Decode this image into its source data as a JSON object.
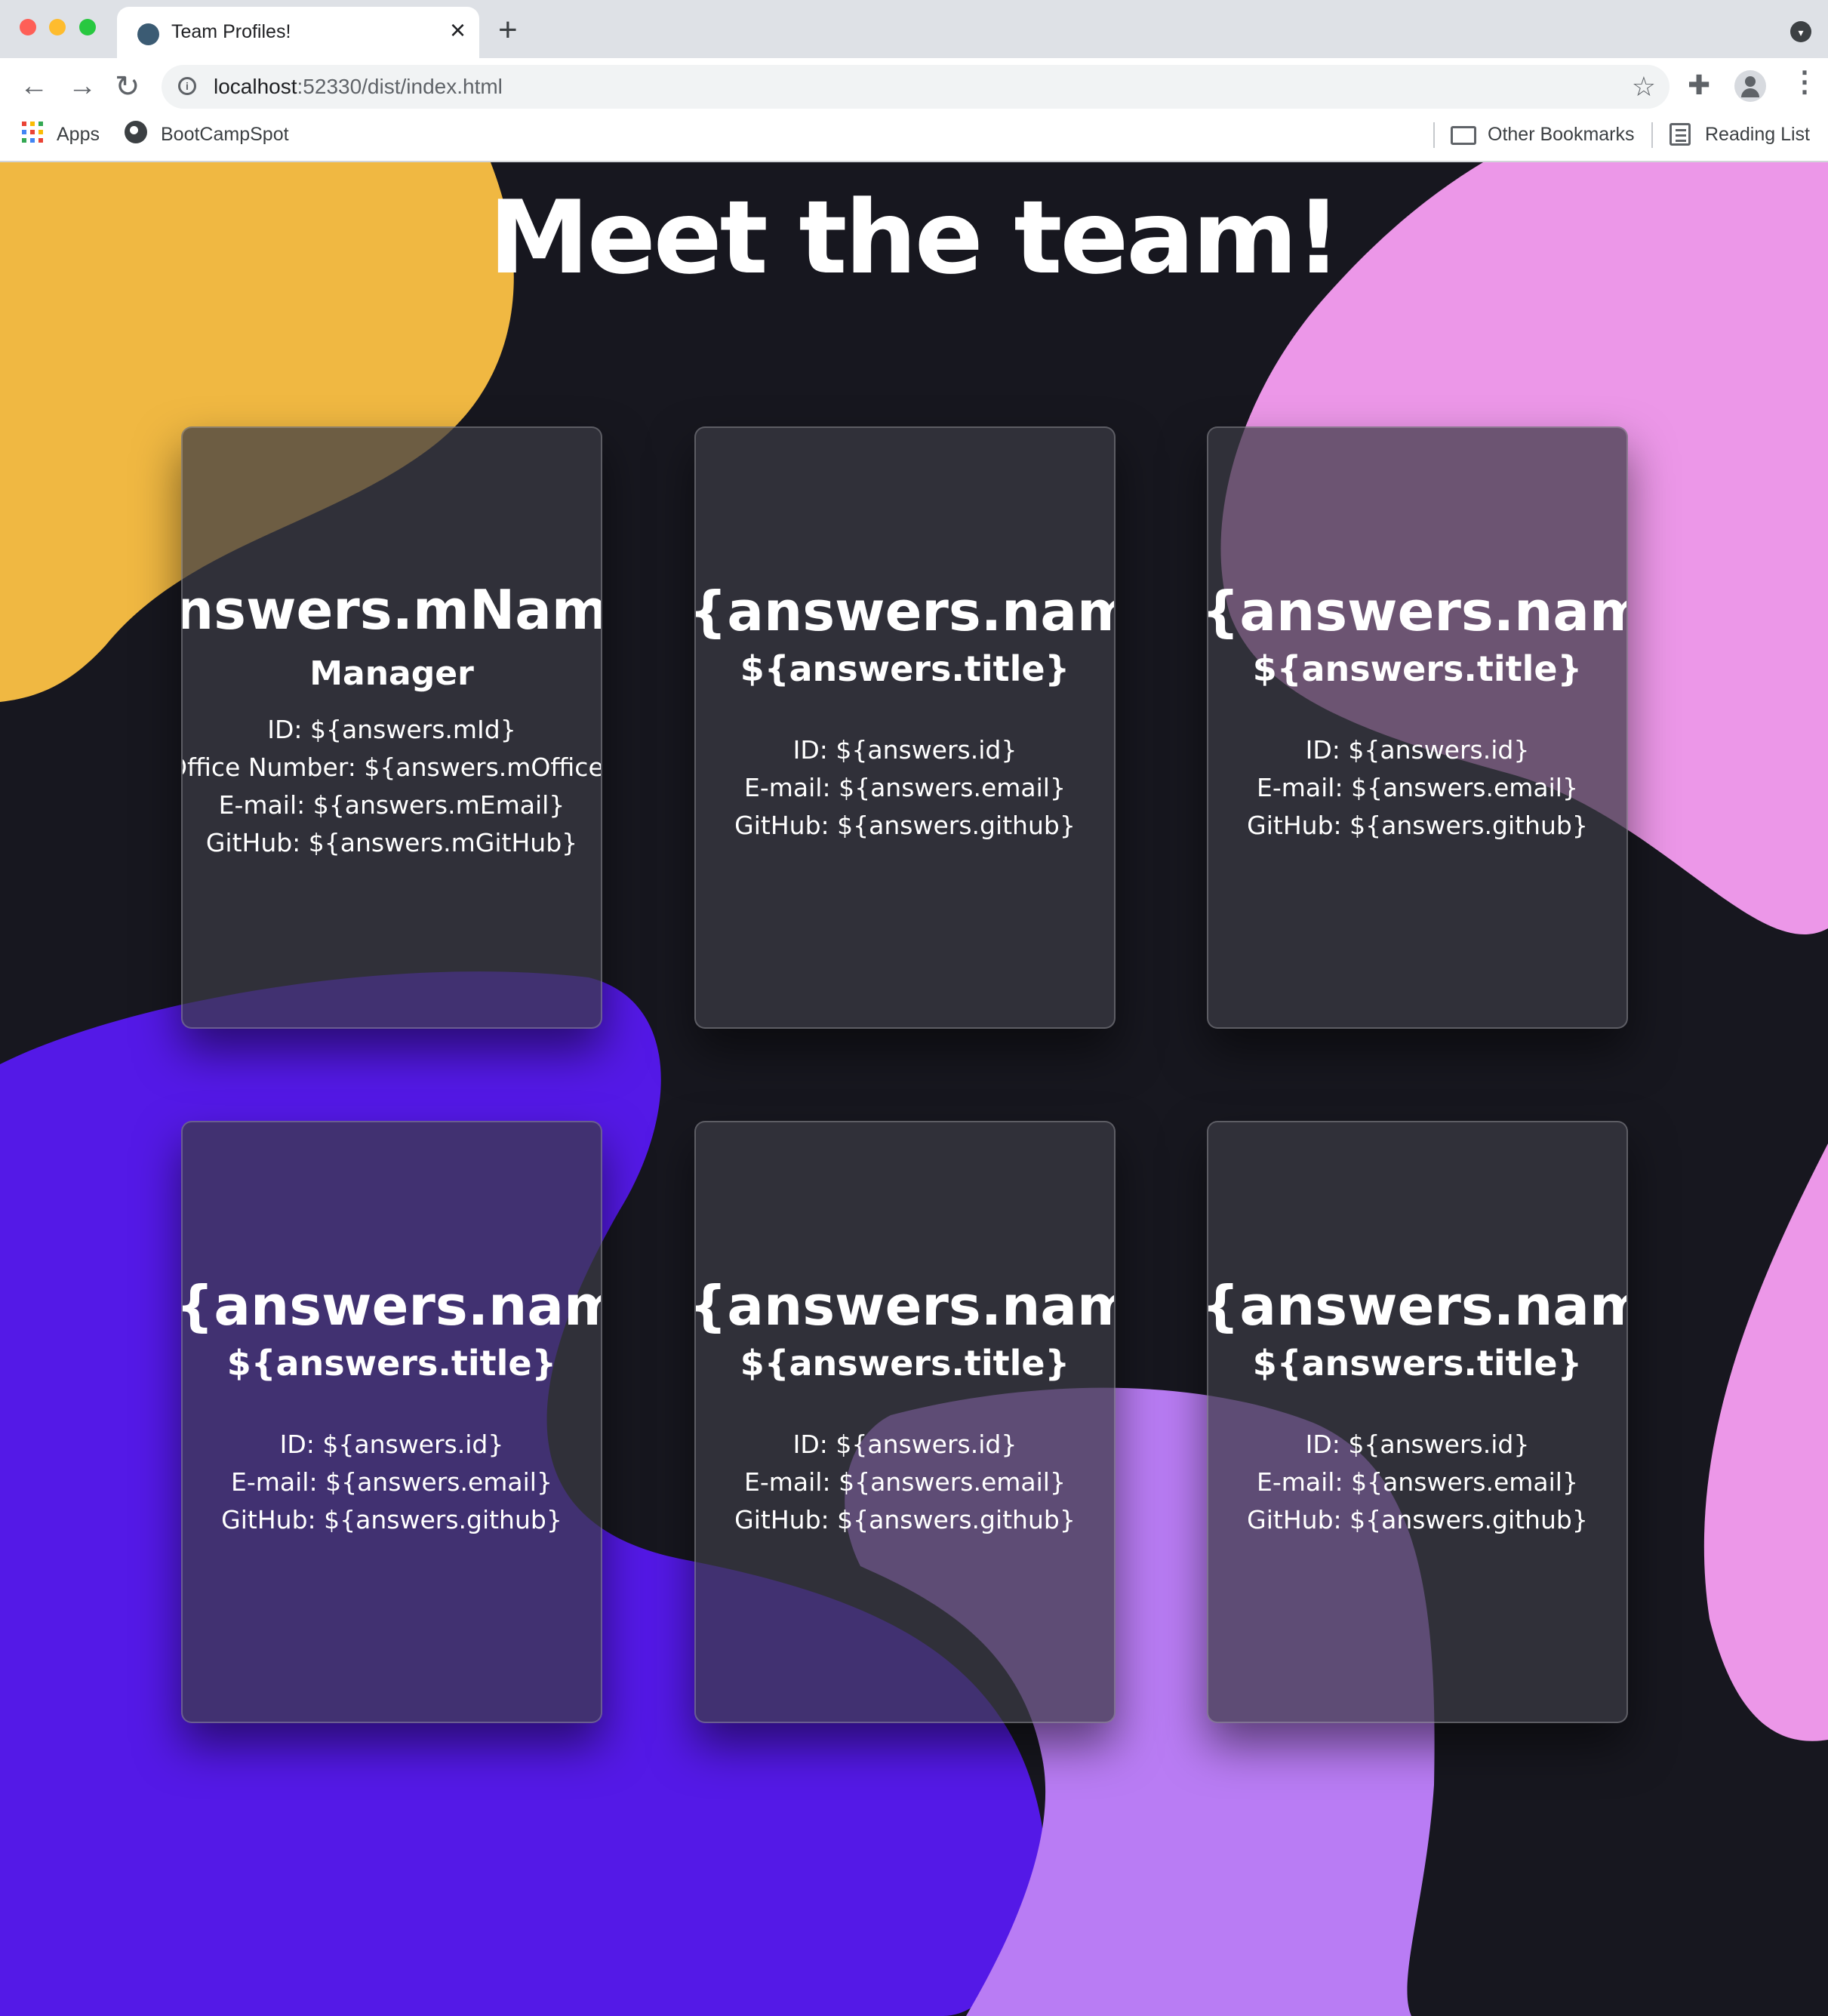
{
  "browser": {
    "tab_title": "Team Profiles!",
    "url_host": "localhost",
    "url_path": ":52330/dist/index.html",
    "bookmarks": [
      "Apps",
      "BootCampSpot"
    ],
    "other_bookmarks": "Other Bookmarks",
    "reading_list": "Reading List",
    "colors": {
      "tabstrip": "#dee1e6",
      "toolbar": "#ffffff",
      "omnibox": "#f1f3f4"
    }
  },
  "page": {
    "heading": "Meet the team!",
    "colors": {
      "background": "#17171f",
      "blob_yellow": "#f0b842",
      "blob_pink": "#ec97e8",
      "blob_indigo": "#5419e7",
      "blob_lilac": "#b97cf4"
    },
    "manager": {
      "name": "answers.mName",
      "role": "Manager",
      "id_line": "ID: ${answers.mId}",
      "office_line": "Office Number: ${answers.mOffice}",
      "email_line": "E-mail: ${answers.mEmail}",
      "github_line": "GitHub: ${answers.mGitHub}"
    },
    "members": [
      {
        "name": "${answers.name}",
        "title": "${answers.title}",
        "id_line": "ID: ${answers.id}",
        "email_line": "E-mail: ${answers.email}",
        "github_line": "GitHub: ${answers.github}"
      },
      {
        "name": "${answers.name}",
        "title": "${answers.title}",
        "id_line": "ID: ${answers.id}",
        "email_line": "E-mail: ${answers.email}",
        "github_line": "GitHub: ${answers.github}"
      },
      {
        "name": "${answers.name}",
        "title": "${answers.title}",
        "id_line": "ID: ${answers.id}",
        "email_line": "E-mail: ${answers.email}",
        "github_line": "GitHub: ${answers.github}"
      },
      {
        "name": "${answers.name}",
        "title": "${answers.title}",
        "id_line": "ID: ${answers.id}",
        "email_line": "E-mail: ${answers.email}",
        "github_line": "GitHub: ${answers.github}"
      },
      {
        "name": "${answers.name}",
        "title": "${answers.title}",
        "id_line": "ID: ${answers.id}",
        "email_line": "E-mail: ${answers.email}",
        "github_line": "GitHub: ${answers.github}"
      }
    ]
  }
}
